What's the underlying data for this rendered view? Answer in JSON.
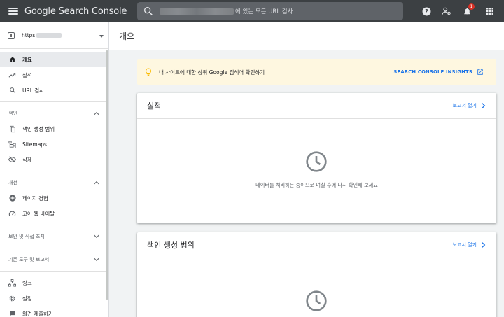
{
  "topbar": {
    "logo": "Google Search Console",
    "search_placeholder": "에 있는 모든 URL 검사",
    "notification_count": "1"
  },
  "sidebar": {
    "property_prefix": "https",
    "nav_top": [
      {
        "label": "개요",
        "icon": "home-icon",
        "active": true
      },
      {
        "label": "실적",
        "icon": "trending-up-icon"
      },
      {
        "label": "URL 검사",
        "icon": "search-icon"
      }
    ],
    "sections": [
      {
        "label": "색인",
        "items": [
          {
            "label": "색인 생성 범위",
            "icon": "file-copy-icon"
          },
          {
            "label": "Sitemaps",
            "icon": "sitemap-icon"
          },
          {
            "label": "삭제",
            "icon": "eye-off-icon"
          }
        ]
      },
      {
        "label": "개선",
        "items": [
          {
            "label": "페이지 경험",
            "icon": "add-circle-icon"
          },
          {
            "label": "코어 웹 바이탈",
            "icon": "speed-gauge-icon"
          }
        ]
      },
      {
        "label": "보안 및 직접 조치"
      },
      {
        "label": "기존 도구 및 보고서"
      }
    ],
    "nav_bottom": [
      {
        "label": "링크",
        "icon": "links-icon"
      },
      {
        "label": "설정",
        "icon": "settings-gear-icon"
      },
      {
        "label": "의견 제출하기",
        "icon": "feedback-icon"
      }
    ]
  },
  "main": {
    "title": "개요",
    "insight": {
      "text": "내 사이트에 대한 상위 Google 검색어 확인하기",
      "link": "SEARCH CONSOLE INSIGHTS"
    },
    "cards": [
      {
        "title": "실적",
        "report_link": "보고서 열기",
        "message": "데이터를 처리하는 중이므로 며칠 후에 다시 확인해 보세요"
      },
      {
        "title": "색인 생성 범위",
        "report_link": "보고서 열기"
      }
    ]
  },
  "colors": {
    "topbar_bg": "#3c4043",
    "accent": "#1a73e8",
    "insight_bg": "#fef7e0",
    "bulb": "#fbbc04",
    "badge": "#d93025"
  }
}
